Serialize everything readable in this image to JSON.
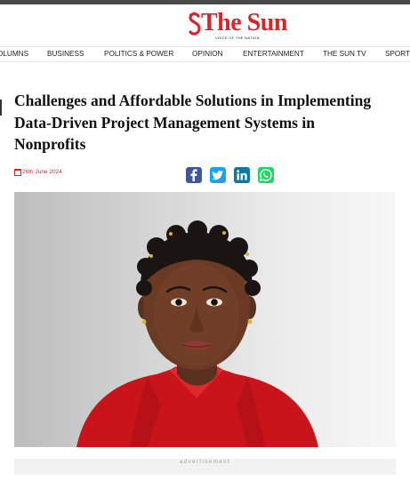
{
  "site": {
    "name": "The Sun",
    "tagline": "VOICE OF THE NATION",
    "brand_color": "#d7262b"
  },
  "nav": {
    "items": [
      {
        "label": "OLUMNS"
      },
      {
        "label": "BUSINESS"
      },
      {
        "label": "POLITICS & POWER"
      },
      {
        "label": "OPINION"
      },
      {
        "label": "ENTERTAINMENT"
      },
      {
        "label": "THE SUN TV"
      },
      {
        "label": "SPORT"
      }
    ]
  },
  "article": {
    "headline": "Challenges and Affordable Solutions in Implementing Data-Driven Project Management Systems in Nonprofits",
    "date": "26th June 2024",
    "date_icon": "calendar-icon",
    "share": [
      {
        "icon": "facebook-icon",
        "color": "#3b5998"
      },
      {
        "icon": "twitter-icon",
        "color": "#1da1f2"
      },
      {
        "icon": "linkedin-icon",
        "color": "#0e76a8"
      },
      {
        "icon": "whatsapp-icon",
        "color": "#25d366"
      }
    ]
  },
  "advertisement": {
    "label": "advertisement"
  }
}
